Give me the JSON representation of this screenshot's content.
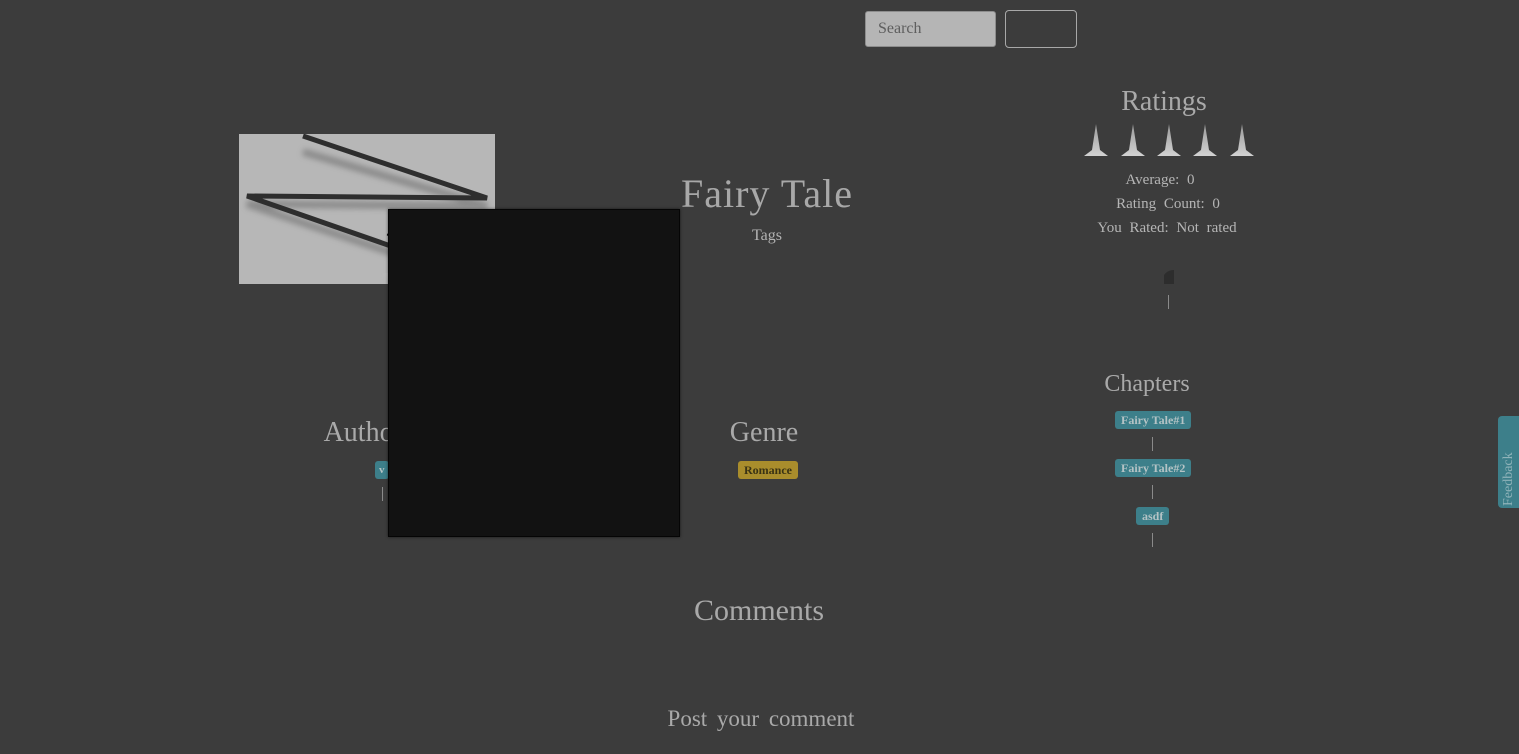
{
  "search": {
    "placeholder": "Search",
    "button_label": ""
  },
  "story": {
    "title": "Fairy Tale",
    "tags_label": "Tags"
  },
  "authors": {
    "heading": "Author(s)",
    "items": [
      {
        "label": "v"
      }
    ]
  },
  "genre": {
    "heading": "Genre",
    "items": [
      {
        "label": "Romance"
      }
    ]
  },
  "ratings": {
    "heading": "Ratings",
    "stars_total": 5,
    "average_label": "Average:",
    "average_value": "0",
    "count_label": "Rating Count:",
    "count_value": "0",
    "you_rated_label": "You Rated:",
    "you_rated_value": "Not rated"
  },
  "chapters": {
    "heading": "Chapters",
    "items": [
      {
        "label": "Fairy Tale#1"
      },
      {
        "label": "Fairy Tale#2"
      },
      {
        "label": "asdf"
      }
    ]
  },
  "comments": {
    "heading": "Comments",
    "post_label": "Post your comment"
  },
  "feedback": {
    "label": "Feedback"
  },
  "colors": {
    "background": "#3c3c3c",
    "badge_teal": "#3d7f8a",
    "badge_gold": "#a98d2c"
  },
  "icons": {
    "cover": "broken-image-zigzag-icon",
    "star": "star-spike-icon",
    "flag": "flag-icon"
  }
}
